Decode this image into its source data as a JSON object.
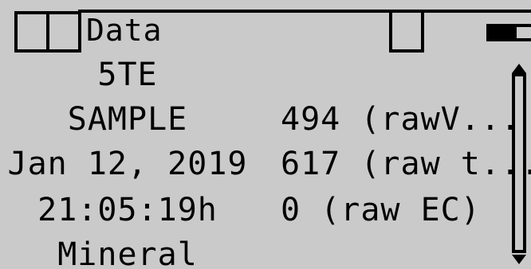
{
  "header": {
    "title": "Data",
    "icons": [
      "status-box-icon",
      "status-box-icon",
      "status-box-icon",
      "battery-icon"
    ]
  },
  "rows": [
    {
      "left": "5TE",
      "right": ""
    },
    {
      "left": "SAMPLE",
      "right": "494 (rawV..."
    },
    {
      "left": "Jan 12, 2019",
      "right": "617 (raw t..."
    },
    {
      "left": "21:05:19h",
      "right": "0 (raw EC)"
    },
    {
      "left": "Mineral",
      "right": ""
    }
  ],
  "battery_level": 0.7,
  "colors": {
    "background": "#cacaca",
    "foreground": "#000000"
  }
}
